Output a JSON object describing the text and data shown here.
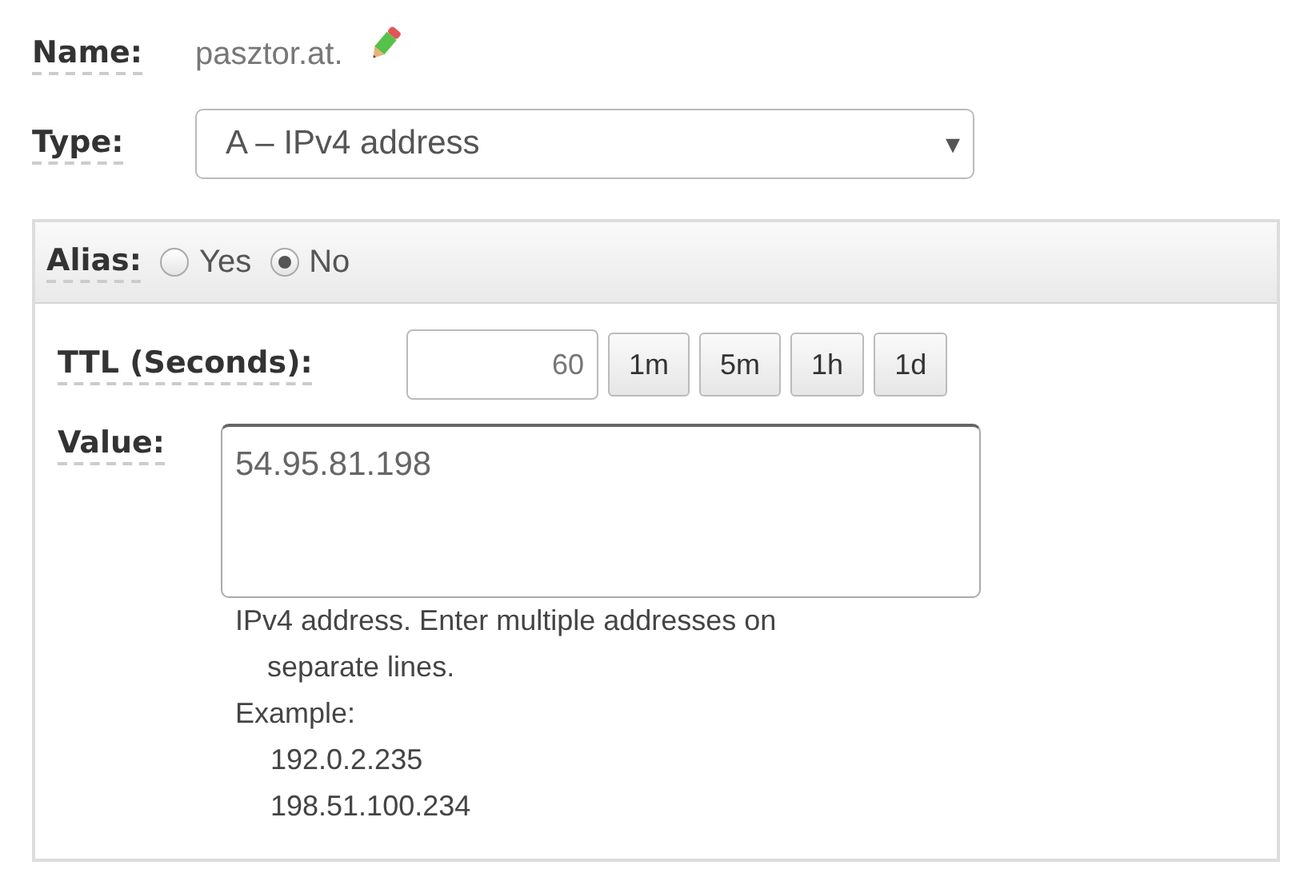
{
  "name": {
    "label": "Name:",
    "value": "pasztor.at."
  },
  "type": {
    "label": "Type:",
    "value": "A – IPv4 address",
    "caret": "▾"
  },
  "alias": {
    "label": "Alias:",
    "options": [
      {
        "label": "Yes",
        "selected": false
      },
      {
        "label": "No",
        "selected": true
      }
    ]
  },
  "ttl": {
    "label": "TTL (Seconds):",
    "value": "60",
    "presets": [
      "1m",
      "5m",
      "1h",
      "1d"
    ]
  },
  "value": {
    "label": "Value:",
    "value": "54.95.81.198",
    "help": "IPv4 address. Enter multiple addresses on separate lines.",
    "example_label": "Example:",
    "examples": [
      "192.0.2.235",
      "198.51.100.234"
    ]
  }
}
